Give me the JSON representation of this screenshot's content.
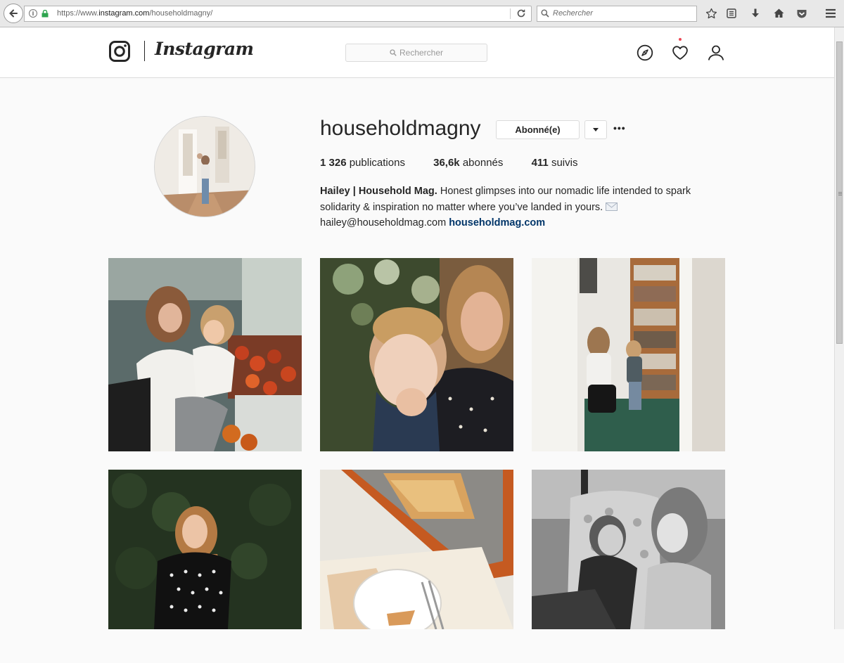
{
  "browser": {
    "url_prefix": "https://www.",
    "url_host": "instagram.com",
    "url_path": "/householdmagny/",
    "search_placeholder": "Rechercher"
  },
  "header": {
    "wordmark": "Instagram",
    "search_placeholder": "Rechercher"
  },
  "profile": {
    "username": "householdmagny",
    "follow_button": "Abonné(e)",
    "more_label": "•••",
    "stats": {
      "posts_count": "1 326",
      "posts_label": "publications",
      "followers_count": "36,6k",
      "followers_label": "abonnés",
      "following_count": "411",
      "following_label": "suivis"
    },
    "bio": {
      "name": "Hailey | Household Mag.",
      "text": "Honest glimpses into our nomadic life intended to spark solidarity & inspiration no matter where you’ve landed in yours.",
      "email": "hailey@householdmag.com",
      "website": "householdmag.com"
    }
  },
  "icons": {
    "browser": [
      "back-arrow-icon",
      "info-icon",
      "lock-icon",
      "reload-icon",
      "search-icon",
      "bookmark-star-icon",
      "reading-list-icon",
      "download-icon",
      "home-icon",
      "pocket-icon",
      "menu-icon"
    ],
    "instagram": [
      "instagram-logo-icon",
      "search-icon",
      "explore-compass-icon",
      "activity-heart-icon",
      "profile-user-icon",
      "mail-emoji-icon",
      "dropdown-caret-icon"
    ]
  },
  "colors": {
    "link": "#003569",
    "notification_dot": "#ed4956",
    "lock_green": "#2ea54f"
  }
}
